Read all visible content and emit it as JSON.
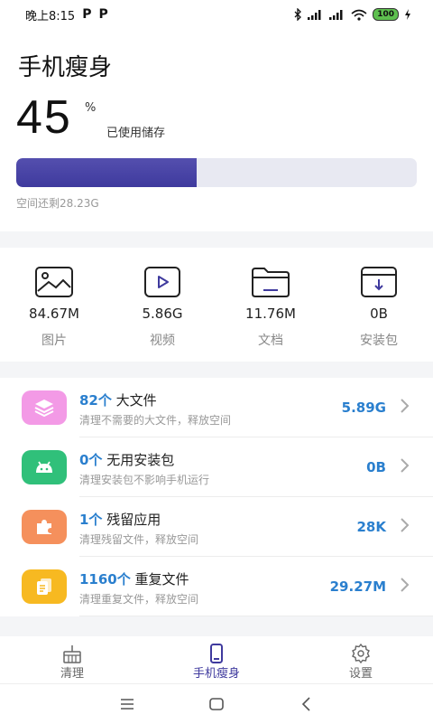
{
  "status": {
    "time": "晚上8:15",
    "notif1": "P",
    "notif2": "P",
    "battery": "100"
  },
  "header": {
    "title": "手机瘦身"
  },
  "storage": {
    "percent": "45",
    "percent_sign": "%",
    "used_label": "已使用储存",
    "used_fraction": 0.45,
    "remaining": "空间还剩28.23G"
  },
  "categories": [
    {
      "size": "84.67M",
      "name": "图片",
      "icon": "image-icon"
    },
    {
      "size": "5.86G",
      "name": "视频",
      "icon": "video-icon"
    },
    {
      "size": "11.76M",
      "name": "文档",
      "icon": "folder-icon"
    },
    {
      "size": "0B",
      "name": "安装包",
      "icon": "package-icon"
    }
  ],
  "items": [
    {
      "count": "82个",
      "title": "大文件",
      "desc": "清理不需要的大文件，释放空间",
      "value": "5.89G",
      "icon": "layers-icon",
      "color": "#f39ae6"
    },
    {
      "count": "0个",
      "title": "无用安装包",
      "desc": "清理安装包不影响手机运行",
      "value": "0B",
      "icon": "android-icon",
      "color": "#30c07a"
    },
    {
      "count": "1个",
      "title": "残留应用",
      "desc": "清理残留文件，释放空间",
      "value": "28K",
      "icon": "puzzle-icon",
      "color": "#f5905c"
    },
    {
      "count": "1160个",
      "title": "重复文件",
      "desc": "清理重复文件，释放空间",
      "value": "29.27M",
      "icon": "copy-file-icon",
      "color": "#f7b921"
    }
  ],
  "tabs": [
    {
      "label": "清理",
      "icon": "broom-icon"
    },
    {
      "label": "手机瘦身",
      "icon": "phone-icon",
      "active": true
    },
    {
      "label": "设置",
      "icon": "gear-icon"
    }
  ],
  "colors": {
    "accent": "#3f3a9e",
    "value_blue": "#2a7fce",
    "bar_track": "#e8e9f2"
  }
}
